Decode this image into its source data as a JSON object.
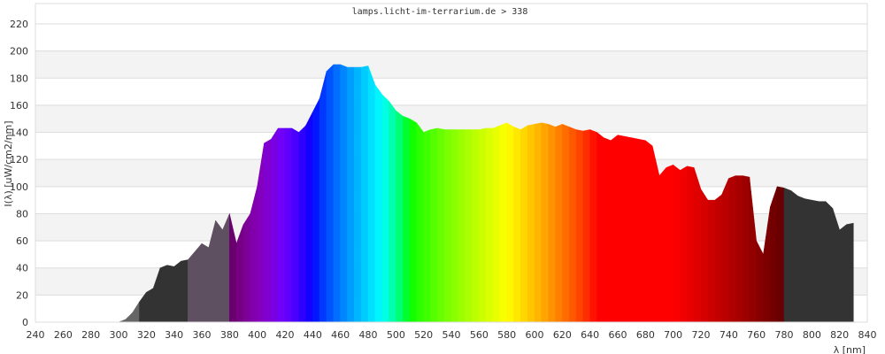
{
  "chart_data": {
    "type": "area",
    "title": "lamps.licht-im-terrarium.de > 338",
    "xlabel": "λ [nm]",
    "ylabel": "I(λ) [uW/cm2/nm]",
    "xlim": [
      240,
      840
    ],
    "ylim": [
      0,
      220
    ],
    "xticks": [
      240,
      260,
      280,
      300,
      320,
      340,
      360,
      380,
      400,
      420,
      440,
      460,
      480,
      500,
      520,
      540,
      560,
      580,
      600,
      620,
      640,
      660,
      680,
      700,
      720,
      740,
      760,
      780,
      800,
      820,
      840
    ],
    "yticks": [
      0,
      20,
      40,
      60,
      80,
      100,
      120,
      140,
      160,
      180,
      200,
      220
    ],
    "grid": true,
    "fill": "wavelength spectrum colours; UV and IR regions grey",
    "region_colors": {
      "uv_b": "#666666",
      "uv_a_low": "#333333",
      "uv_a_high": "#5e5060",
      "ir": "#333333"
    },
    "x": [
      300,
      305,
      310,
      315,
      320,
      325,
      330,
      335,
      340,
      345,
      350,
      355,
      360,
      365,
      370,
      375,
      380,
      385,
      390,
      395,
      400,
      405,
      410,
      415,
      420,
      425,
      430,
      435,
      440,
      445,
      450,
      455,
      460,
      465,
      470,
      475,
      480,
      485,
      490,
      495,
      500,
      505,
      510,
      515,
      520,
      525,
      530,
      535,
      540,
      545,
      550,
      555,
      560,
      565,
      570,
      575,
      580,
      585,
      590,
      595,
      600,
      605,
      610,
      615,
      620,
      625,
      630,
      635,
      640,
      645,
      650,
      655,
      660,
      665,
      670,
      675,
      680,
      685,
      690,
      695,
      700,
      705,
      710,
      715,
      720,
      725,
      730,
      735,
      740,
      745,
      750,
      755,
      760,
      765,
      770,
      775,
      780,
      785,
      790,
      795,
      800,
      805,
      810,
      815,
      820,
      825,
      830
    ],
    "y": [
      0,
      2,
      7,
      15,
      22,
      25,
      40,
      42,
      41,
      45,
      46,
      52,
      58,
      55,
      75,
      68,
      80,
      58,
      72,
      80,
      100,
      132,
      135,
      143,
      143,
      143,
      140,
      145,
      155,
      165,
      185,
      190,
      190,
      188,
      188,
      188,
      189,
      175,
      168,
      163,
      156,
      152,
      150,
      147,
      140,
      142,
      143,
      142,
      142,
      142,
      142,
      142,
      142,
      143,
      143,
      145,
      147,
      144,
      142,
      145,
      146,
      147,
      146,
      144,
      146,
      144,
      142,
      141,
      142,
      140,
      136,
      134,
      138,
      137,
      136,
      135,
      134,
      130,
      108,
      114,
      116,
      112,
      115,
      114,
      98,
      90,
      90,
      94,
      106,
      108,
      108,
      107,
      60,
      50,
      85,
      100,
      99,
      97,
      93,
      91,
      90,
      89,
      89,
      84,
      68,
      72,
      73
    ]
  }
}
